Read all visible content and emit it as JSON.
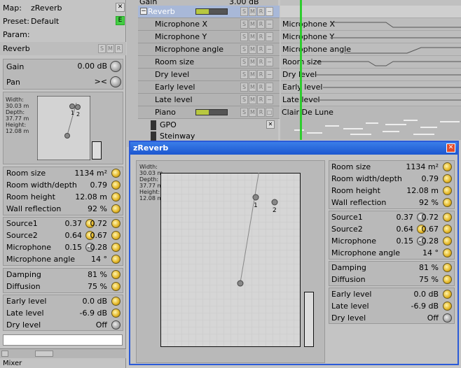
{
  "left": {
    "map_label": "Map:",
    "map_value": "zReverb",
    "preset_label": "Preset:",
    "preset_value": "Default",
    "param_label": "Param:",
    "section": "Reverb",
    "gain": {
      "label": "Gain",
      "value": "0.00 dB"
    },
    "pan": {
      "label": "Pan",
      "value": "><"
    },
    "dims": {
      "width_label": "Width:",
      "width_value": "30.03 m",
      "depth_label": "Depth:",
      "depth_value": "37.77 m",
      "height_label": "Height:",
      "height_value": "12.08 m"
    },
    "source_labels": [
      "1",
      "2"
    ],
    "room": [
      {
        "label": "Room size",
        "value": "1134 m²"
      },
      {
        "label": "Room width/depth",
        "value": "0.79"
      },
      {
        "label": "Room height",
        "value": "12.08 m"
      },
      {
        "label": "Wall reflection",
        "value": "92 %"
      }
    ],
    "sources": [
      {
        "label": "Source1",
        "v1": "0.37",
        "v2": "0.72"
      },
      {
        "label": "Source2",
        "v1": "0.64",
        "v2": "0.67"
      },
      {
        "label": "Microphone",
        "v1": "0.15",
        "v2": "-0.28"
      }
    ],
    "mic_angle": {
      "label": "Microphone angle",
      "value": "14 °"
    },
    "damp": [
      {
        "label": "Damping",
        "value": "81 %"
      },
      {
        "label": "Diffusion",
        "value": "75 %"
      }
    ],
    "levels": [
      {
        "label": "Early level",
        "value": "0.0 dB"
      },
      {
        "label": "Late level",
        "value": "-6.9 dB"
      },
      {
        "label": "Dry level",
        "value": "Off"
      }
    ],
    "status": "Mixer"
  },
  "tracks": {
    "gain_label": "Gain",
    "gain_value": "3.00 dB",
    "reverb": "Reverb",
    "items": [
      "Microphone X",
      "Microphone Y",
      "Microphone angle",
      "Room size",
      "Dry level",
      "Early level",
      "Late level"
    ],
    "piano": "Piano",
    "piano_clip": "Clair De Lune",
    "gpo": "GPO",
    "steinway": "Steinway",
    "smr": [
      "S",
      "M",
      "R"
    ]
  },
  "window": {
    "title": "zReverb",
    "dims": {
      "width_label": "Width:",
      "width_value": "30.03 m",
      "depth_label": "Depth:",
      "depth_value": "37.77 m",
      "height_label": "Height:",
      "height_value": "12.08 m"
    },
    "source_labels": [
      "1",
      "2"
    ],
    "room": [
      {
        "label": "Room size",
        "value": "1134 m²"
      },
      {
        "label": "Room width/depth",
        "value": "0.79"
      },
      {
        "label": "Room height",
        "value": "12.08 m"
      },
      {
        "label": "Wall reflection",
        "value": "92 %"
      }
    ],
    "sources": [
      {
        "label": "Source1",
        "v1": "0.37",
        "v2": "0.72"
      },
      {
        "label": "Source2",
        "v1": "0.64",
        "v2": "0.67"
      },
      {
        "label": "Microphone",
        "v1": "0.15",
        "v2": "-0.28"
      }
    ],
    "mic_angle": {
      "label": "Microphone angle",
      "value": "14 °"
    },
    "damp": [
      {
        "label": "Damping",
        "value": "81 %"
      },
      {
        "label": "Diffusion",
        "value": "75 %"
      }
    ],
    "levels": [
      {
        "label": "Early level",
        "value": "0.0 dB"
      },
      {
        "label": "Late level",
        "value": "-6.9 dB"
      },
      {
        "label": "Dry level",
        "value": "Off"
      }
    ]
  },
  "colors": {
    "accent": "#2a5ad8",
    "knob": "#e3b422",
    "playhead": "#2ecc2e"
  }
}
